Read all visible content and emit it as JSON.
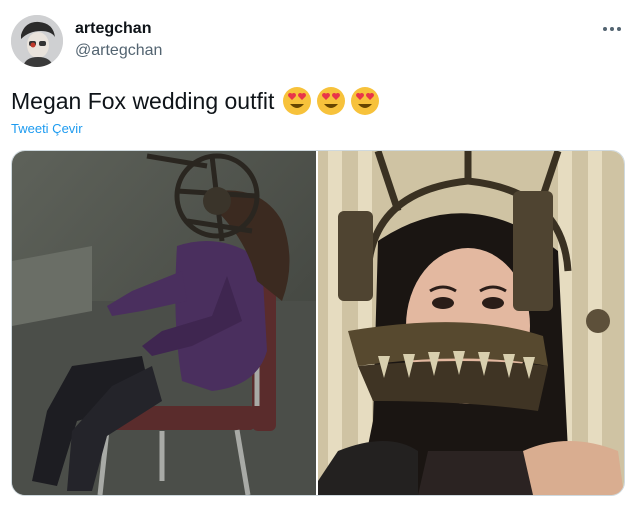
{
  "user": {
    "display_name": "artegchan",
    "handle": "@artegchan"
  },
  "tweet": {
    "text": "Megan Fox wedding outfit",
    "emojis": [
      "heart-eyes-emoji",
      "heart-eyes-emoji",
      "heart-eyes-emoji"
    ],
    "translate_label": "Tweeti Çevir"
  },
  "icons": {
    "more": "more-options-icon",
    "avatar": "avatar"
  },
  "media": {
    "count": 2
  },
  "colors": {
    "text": "#0f1419",
    "secondary": "#536471",
    "link": "#1d9bf0",
    "border": "#cfd9de"
  }
}
